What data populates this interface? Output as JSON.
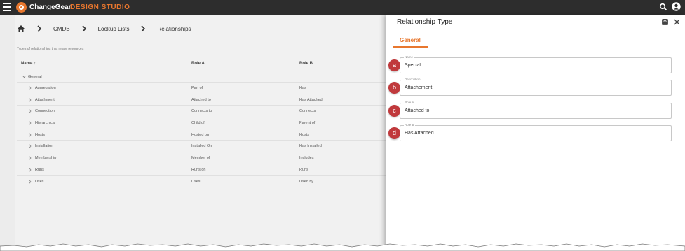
{
  "app": {
    "brand_name": "ChangeGear",
    "brand_sub": "DESIGN STUDIO"
  },
  "breadcrumb": [
    "CMDB",
    "Lookup Lists",
    "Relationships"
  ],
  "list": {
    "description": "Types of relationships that relate resources",
    "columns": [
      "Name ↑",
      "Role A",
      "Role B"
    ],
    "group": "General",
    "rows": [
      [
        "Aggregation",
        "Part of",
        "Has"
      ],
      [
        "Attachment",
        "Attached to",
        "Has Attached"
      ],
      [
        "Connection",
        "Connects to",
        "Connects"
      ],
      [
        "Hierarchical",
        "Child of",
        "Parent of"
      ],
      [
        "Hosts",
        "Hosted on",
        "Hosts"
      ],
      [
        "Installation",
        "Installed On",
        "Has Installed"
      ],
      [
        "Membership",
        "Member of",
        "Includes"
      ],
      [
        "Runs",
        "Runs on",
        "Runs"
      ],
      [
        "Uses",
        "Uses",
        "Used by"
      ]
    ]
  },
  "panel": {
    "title": "Relationship Type",
    "tab": "General",
    "fields": [
      {
        "badge": "a",
        "label": "Name",
        "value": "Special"
      },
      {
        "badge": "b",
        "label": "Description",
        "value": "Attachement"
      },
      {
        "badge": "c",
        "label": "Role A",
        "value": "Attached to"
      },
      {
        "badge": "d",
        "label": "Role B",
        "value": "Has Attached"
      }
    ]
  },
  "icons": {
    "menu": "hamburger-menu-icon",
    "brand": "changegear-logo-icon",
    "search": "search-icon",
    "user": "user-account-icon",
    "home": "home-icon",
    "save": "save-icon",
    "close": "close-icon"
  },
  "colors": {
    "accent": "#e8772e",
    "topbar": "#2d2d2d",
    "badge": "#c0393c"
  }
}
